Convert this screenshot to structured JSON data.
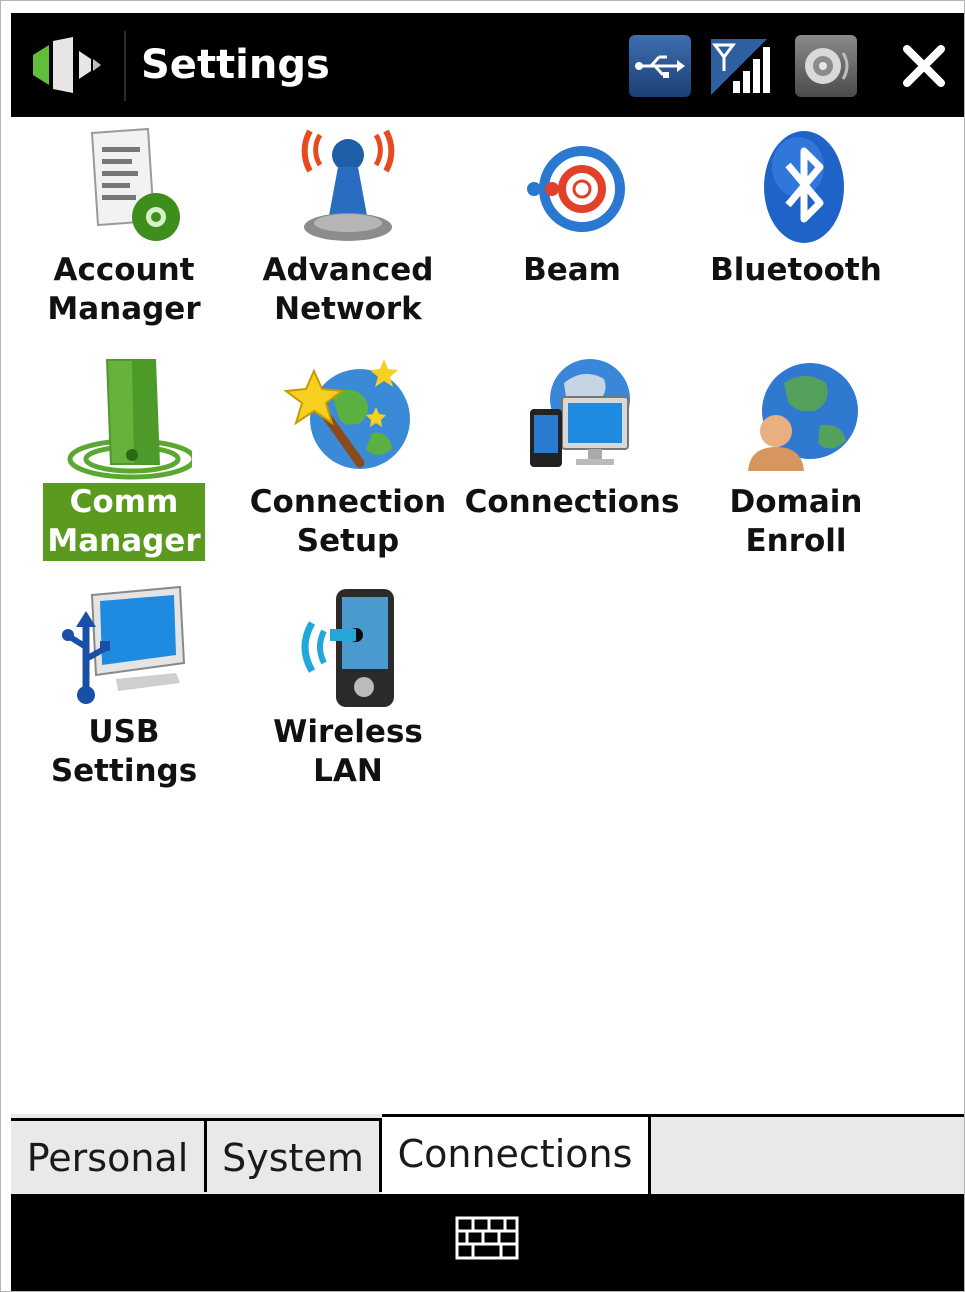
{
  "titlebar": {
    "title": "Settings",
    "icons": [
      "windows-start-icon",
      "usb-connection-icon",
      "signal-strength-icon",
      "volume-icon",
      "close-icon"
    ]
  },
  "items": [
    {
      "name": "account-manager",
      "label": "Account\nManager",
      "icon": "account-manager-icon",
      "selected": false
    },
    {
      "name": "advanced-network",
      "label": "Advanced\nNetwork",
      "icon": "advanced-network-icon",
      "selected": false
    },
    {
      "name": "beam",
      "label": "Beam",
      "icon": "beam-icon",
      "selected": false
    },
    {
      "name": "bluetooth",
      "label": "Bluetooth",
      "icon": "bluetooth-icon",
      "selected": false
    },
    {
      "name": "comm-manager",
      "label": "Comm\nManager",
      "icon": "comm-manager-icon",
      "selected": true
    },
    {
      "name": "connection-setup",
      "label": "Connection\nSetup",
      "icon": "connection-setup-icon",
      "selected": false
    },
    {
      "name": "connections",
      "label": "Connections",
      "icon": "connections-icon",
      "selected": false
    },
    {
      "name": "domain-enroll",
      "label": "Domain\nEnroll",
      "icon": "domain-enroll-icon",
      "selected": false
    },
    {
      "name": "usb-settings",
      "label": "USB Settings",
      "icon": "usb-settings-icon",
      "selected": false
    },
    {
      "name": "wireless-lan",
      "label": "Wireless LAN",
      "icon": "wireless-lan-icon",
      "selected": false
    }
  ],
  "tabs": [
    {
      "label": "Personal",
      "active": false
    },
    {
      "label": "System",
      "active": false
    },
    {
      "label": "Connections",
      "active": true
    }
  ],
  "bottombar": {
    "icons": [
      "keyboard-icon"
    ]
  },
  "colors": {
    "selection": "#5a9b1f",
    "titlebar": "#000000",
    "tab_bg": "#e9e9e9"
  }
}
